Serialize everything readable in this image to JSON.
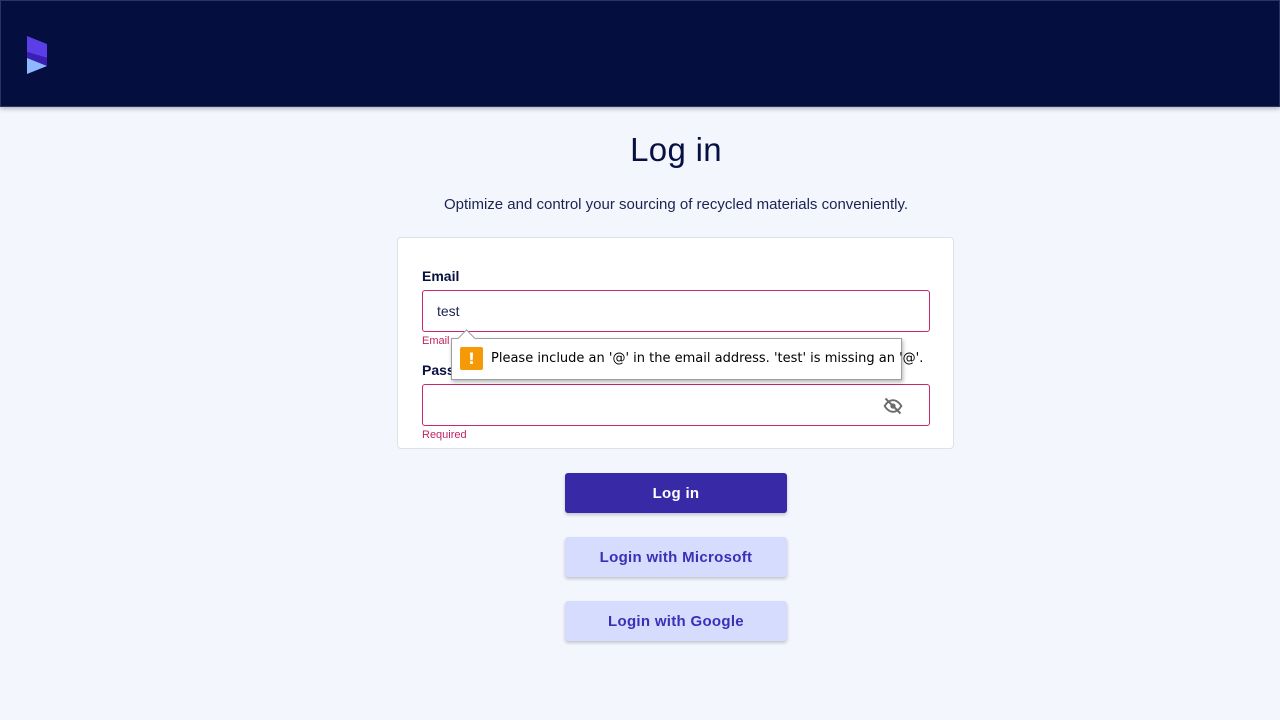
{
  "header": {
    "logo_icon": "brand-logo-icon",
    "background": "#040f3f"
  },
  "page": {
    "title": "Log in",
    "subtitle": "Optimize and control your sourcing of recycled materials conveniently."
  },
  "form": {
    "email": {
      "label": "Email",
      "value": "test",
      "error": "Email"
    },
    "password": {
      "label": "Pass",
      "value": "",
      "error": "Required",
      "toggle_icon": "eye-off-icon"
    },
    "validation_tooltip": {
      "icon": "warning-icon",
      "icon_glyph": "!",
      "message": "Please include an '@' in the email address. 'test' is missing an '@'."
    }
  },
  "actions": {
    "login_label": "Log in",
    "microsoft_label": "Login with Microsoft",
    "google_label": "Login with Google"
  },
  "colors": {
    "primary": "#3829a7",
    "secondary_bg": "#d6dcfd",
    "error": "#c8276b",
    "warning": "#f59a06"
  }
}
